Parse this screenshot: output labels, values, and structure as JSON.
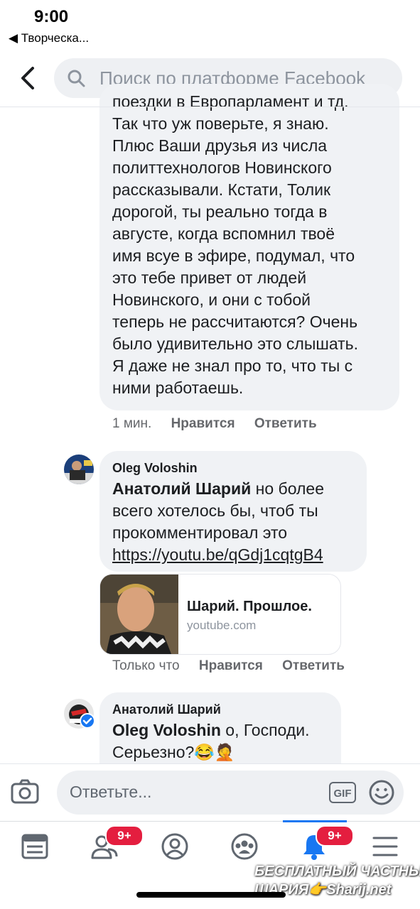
{
  "status_bar": {
    "time": "9:00",
    "back_app": "◀ Творческа..."
  },
  "header": {
    "search_placeholder": "Поиск по платформе Facebook"
  },
  "comments": [
    {
      "text_lines": [
        "поездки в Европарламент и тд.",
        "Так что уж поверьте, я знаю.",
        "Плюс Ваши друзья из числа",
        "политтехнологов Новинского",
        "рассказывали. Кстати, Толик",
        "дорогой, ты реально тогда в",
        "августе, когда вспомнил твоё",
        "имя всуе в эфире, подумал, что",
        "это тебе привет от людей",
        "Новинского, и они с тобой",
        "теперь не рассчитаются? Очень",
        "было удивительно это слышать.",
        "Я даже не знал про то, что ты с",
        "ними работаешь."
      ],
      "time": "1 мин.",
      "like": "Нравится",
      "reply": "Ответить"
    },
    {
      "author": "Oleg Voloshin",
      "mention": "Анатолий Шарий",
      "text_lines": [
        " но более",
        "всего хотелось бы, чтоб ты",
        "прокомментировал это"
      ],
      "link": "https://youtu.be/qGdj1cqtgB4",
      "preview": {
        "title": "Шарий. Прошлое.",
        "domain": "youtube.com"
      },
      "time": "Только что",
      "like": "Нравится",
      "reply": "Ответить"
    },
    {
      "author": "Анатолий Шарий",
      "mention": "Oleg Voloshin",
      "text_lines": [
        " о, Господи.",
        "Серьезно?😂🤦"
      ]
    }
  ],
  "composer": {
    "placeholder": "Ответьте...",
    "gif_label": "GIF"
  },
  "tabbar": {
    "friends_badge": "9+",
    "notifications_badge": "9+"
  },
  "watermark": {
    "line1": "БЕСПЛАТНЫЙ ЧАСТНЫЙ",
    "line2": "ШАРИЯ👉Sharij.net"
  },
  "colors": {
    "accent": "#1877f2",
    "badge": "#e41e3f",
    "bubble": "#f0f2f5"
  }
}
